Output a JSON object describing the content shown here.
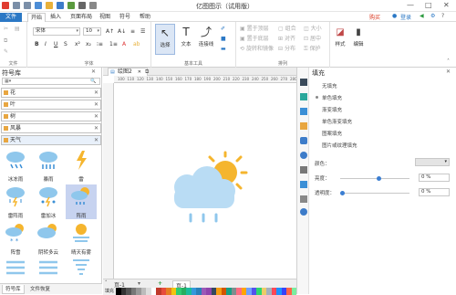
{
  "app": {
    "title": "亿图图示（试用版）"
  },
  "window_controls": {
    "minimize": "—",
    "maximize": "□",
    "close": "✕"
  },
  "menu": {
    "file": "文件",
    "items": [
      "开始",
      "插入",
      "页面布局",
      "视图",
      "符号",
      "帮助"
    ],
    "right": {
      "buy": "购买",
      "login": "登录",
      "share": "分享"
    }
  },
  "ribbon": {
    "font_name": "宋体",
    "font_size": "10",
    "groups": {
      "file": "文件",
      "font": "字体",
      "basic_tools": "基本工具",
      "arrange": "排列"
    },
    "tools": {
      "select": "选择",
      "text": "文本",
      "connector": "连接线"
    },
    "arrange_items": [
      "置于顶层",
      "置于底层",
      "旋转和镜像",
      "组合",
      "对齐",
      "分布",
      "大小",
      "居中",
      "保护"
    ],
    "right_tools": {
      "style": "样式",
      "edit": "编辑"
    }
  },
  "left_panel": {
    "title": "符号库",
    "categories": [
      "花",
      "叶",
      "树",
      "风暴",
      "天气"
    ],
    "symbols": [
      "冰冻雨",
      "暴雨",
      "雷",
      "雷阵雨",
      "雷加冰",
      "阵雨",
      "阵雪",
      "阴转多云",
      "晴天有雾"
    ],
    "tabs": [
      "符号库",
      "文件恢复"
    ]
  },
  "document": {
    "tab": "绘图2",
    "ruler_h": [
      "100",
      "110",
      "120",
      "130",
      "140",
      "150",
      "160",
      "170",
      "180",
      "190",
      "200",
      "210",
      "220",
      "230",
      "240",
      "250",
      "260",
      "270",
      "280"
    ],
    "page_nav": "页-1",
    "page_tab": "页-1",
    "fill_label": "填充"
  },
  "right_panel": {
    "title": "填充",
    "options": [
      "无填充",
      "单色填充",
      "渐变填充",
      "单色渐变填充",
      "图案填充",
      "图片或纹理填充"
    ],
    "props": {
      "color_label": "颜色：",
      "brightness_label": "亮度：",
      "brightness_value": "0 %",
      "transparency_label": "透明度：",
      "transparency_value": "0 %"
    }
  },
  "colors": {
    "accent": "#2b78c5",
    "cloud": "#b9dcf4",
    "sun": "#f5b52e",
    "rain": "#8fc7ec",
    "selected": "#c7d3f0"
  }
}
